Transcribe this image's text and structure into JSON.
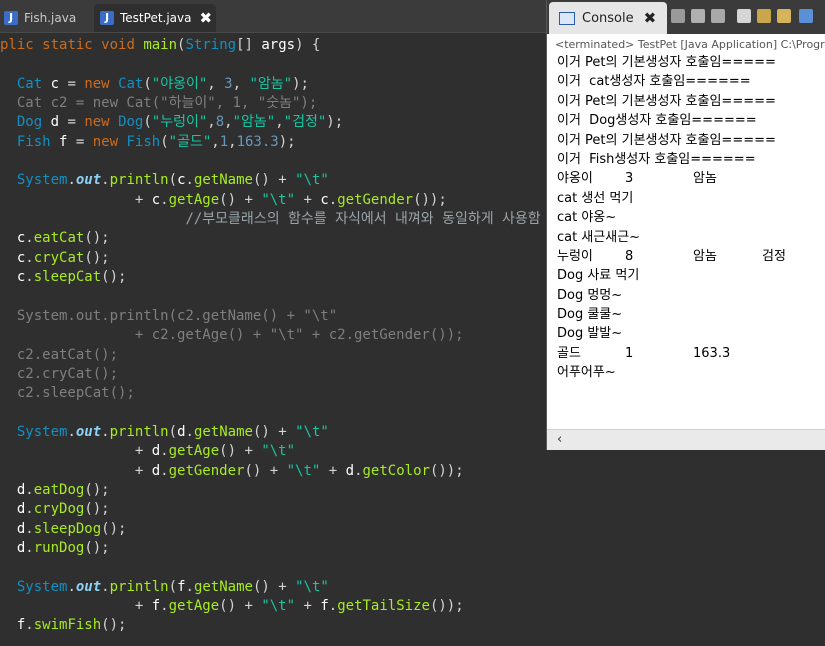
{
  "editor": {
    "tabs": [
      {
        "icon": "J",
        "label": "Fish.java"
      },
      {
        "icon": "J",
        "label": "TestPet.java",
        "close": "✖"
      }
    ],
    "code": [
      "plic static void main(String[] args) {",
      "",
      "  Cat c = new Cat(\"야옹이\", 3, \"암놈\");",
      "  Cat c2 = new Cat(\"하늘이\", 1, \"숫놈\");",
      "  Dog d = new Dog(\"누렁이\",8,\"암놈\",\"검정\");",
      "  Fish f = new Fish(\"골드\",1,163.3);",
      "",
      "  System.out.println(c.getName() + \"\\t\"",
      "                + c.getAge() + \"\\t\" + c.getGender());",
      "                      //부모클래스의 함수를 자식에서 내껴와 동일하게 사용함",
      "  c.eatCat();",
      "  c.cryCat();",
      "  c.sleepCat();",
      "",
      "  System.out.println(c2.getName() + \"\\t\"",
      "                + c2.getAge() + \"\\t\" + c2.getGender());",
      "  c2.eatCat();",
      "  c2.cryCat();",
      "  c2.sleepCat();",
      "",
      "  System.out.println(d.getName() + \"\\t\"",
      "                + d.getAge() + \"\\t\"",
      "                + d.getGender() + \"\\t\" + d.getColor());",
      "  d.eatDog();",
      "  d.cryDog();",
      "  d.sleepDog();",
      "  d.runDog();",
      "",
      "  System.out.println(f.getName() + \"\\t\"",
      "                + f.getAge() + \"\\t\" + f.getTailSize());",
      "  f.swimFish();"
    ]
  },
  "console": {
    "tab_label": "Console",
    "close": "✖",
    "status": "<terminated> TestPet [Java Application] C:\\Progr",
    "lines": [
      [
        "이거 Pet의 기본생성자 호출임====="
      ],
      [
        "이거  cat생성자 호출임======"
      ],
      [
        "이거 Pet의 기본생성자 호출임====="
      ],
      [
        "이거  Dog생성자 호출임======"
      ],
      [
        "이거 Pet의 기본생성자 호출임====="
      ],
      [
        "이거  Fish생성자 호출임======"
      ],
      [
        "야옹이",
        "3",
        "암놈"
      ],
      [
        "cat 생선 먹기"
      ],
      [
        "cat 야옹~"
      ],
      [
        "cat 새근새근~"
      ],
      [
        "누렁이",
        "8",
        "암놈",
        "검정"
      ],
      [
        "Dog 사료 먹기"
      ],
      [
        "Dog 멍멍~"
      ],
      [
        "Dog 쿨쿨~"
      ],
      [
        "Dog 발발~"
      ],
      [
        "골드",
        "1",
        "163.3"
      ],
      [
        "어푸어푸~"
      ]
    ],
    "scroll_left": "‹"
  }
}
